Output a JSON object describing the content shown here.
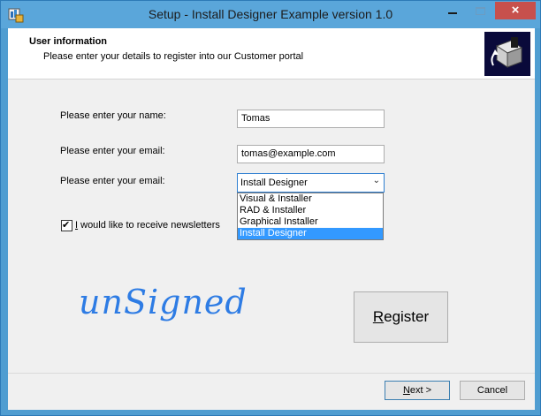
{
  "window": {
    "title": "Setup - Install Designer Example version 1.0",
    "close_glyph": "×",
    "accent": "#5aa6da",
    "close_color": "#c7504c"
  },
  "header": {
    "title": "User information",
    "subtitle": "Please enter your details to register into our Customer portal",
    "logo_icon": "installer-box-icon"
  },
  "form": {
    "name_label": "Please enter your name:",
    "name_value": "Tomas",
    "email_label": "Please enter your email:",
    "email_value": "tomas@example.com",
    "product_label": "Please enter your email:",
    "product_selected": "Install Designer",
    "product_options": [
      "Visual & Installer",
      "RAD & Installer",
      "Graphical Installer",
      "Install Designer"
    ],
    "newsletter_checked": true,
    "newsletter_label_prefix": "I",
    "newsletter_label_rest": " would like to receive newsletters"
  },
  "watermark": "unSigned",
  "buttons": {
    "register_prefix": "R",
    "register_rest": "egister",
    "next_prefix": "N",
    "next_rest": "ext >",
    "cancel": "Cancel"
  }
}
